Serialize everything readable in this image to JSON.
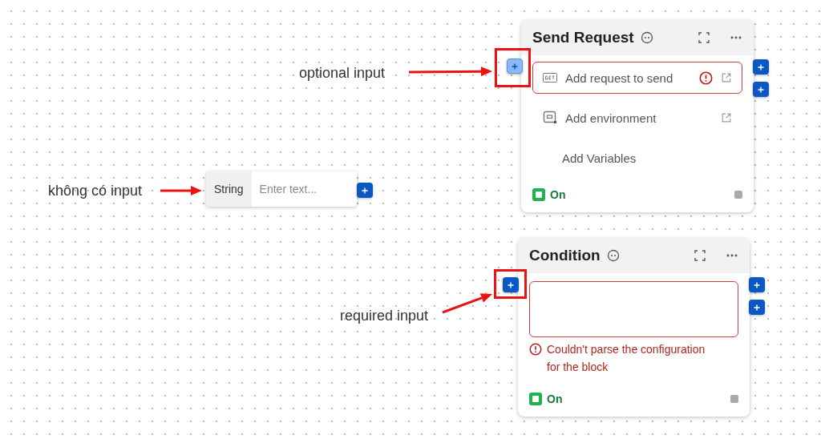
{
  "annotations": [
    {
      "text": "optional input"
    },
    {
      "text": "không có input"
    },
    {
      "text": "required input"
    }
  ],
  "string_node": {
    "type_label": "String",
    "placeholder": "Enter text..."
  },
  "blocks": [
    {
      "title": "Send Request",
      "input_port": {
        "required": false
      },
      "has_error": false,
      "rows": [
        {
          "kind": "request",
          "text": "Add request to send",
          "error": true
        },
        {
          "kind": "environment",
          "text": "Add environment"
        },
        {
          "kind": "variables",
          "text": "Add Variables"
        }
      ],
      "switch": {
        "label": "On",
        "on": true
      }
    },
    {
      "title": "Condition",
      "input_port": {
        "required": true
      },
      "has_error": true,
      "error_message": "Couldn't parse the configuration for the block",
      "switch": {
        "label": "On",
        "on": true
      }
    }
  ]
}
